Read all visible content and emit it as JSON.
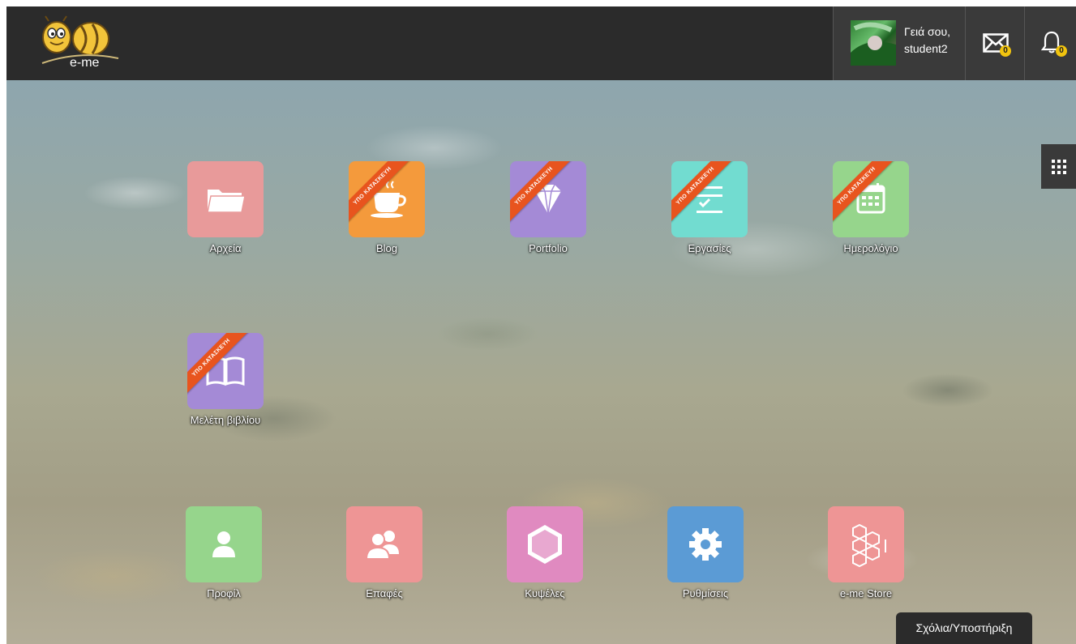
{
  "header": {
    "logo_text": "e-me",
    "greeting": "Γειά σου,",
    "username": "student2",
    "messages_count": "0",
    "notifications_count": "0"
  },
  "ribbon_text": "ΥΠΟ ΚΑΤΑΣΚΕΥΗ",
  "apps": [
    {
      "label": "Αρχεία",
      "color": "#e89a9a",
      "icon": "folder-icon",
      "ribbon": false
    },
    {
      "label": "Blog",
      "color": "#f49a3c",
      "icon": "coffee-cup-icon",
      "ribbon": true
    },
    {
      "label": "Portfolio",
      "color": "#a48ad6",
      "icon": "diamond-icon",
      "ribbon": true
    },
    {
      "label": "Εργασίες",
      "color": "#72dcd0",
      "icon": "checklist-icon",
      "ribbon": true
    },
    {
      "label": "Ημερολόγιο",
      "color": "#96d58c",
      "icon": "calendar-icon",
      "ribbon": true
    },
    {
      "label": "Μελέτη βιβλίου",
      "color": "#a48ad6",
      "icon": "open-book-icon",
      "ribbon": true
    }
  ],
  "bottom_apps": [
    {
      "label": "Προφίλ",
      "color": "#96d58c",
      "icon": "user-icon"
    },
    {
      "label": "Επαφές",
      "color": "#ee9595",
      "icon": "contacts-icon"
    },
    {
      "label": "Κυψέλες",
      "color": "#e08ac0",
      "icon": "hexagon-icon"
    },
    {
      "label": "Ρυθμίσεις",
      "color": "#5b9bd5",
      "icon": "gear-icon"
    },
    {
      "label": "e-me Store",
      "color": "#ee9595",
      "icon": "honeycomb-icon"
    }
  ],
  "feedback_label": "Σχόλια/Υποστήριξη"
}
